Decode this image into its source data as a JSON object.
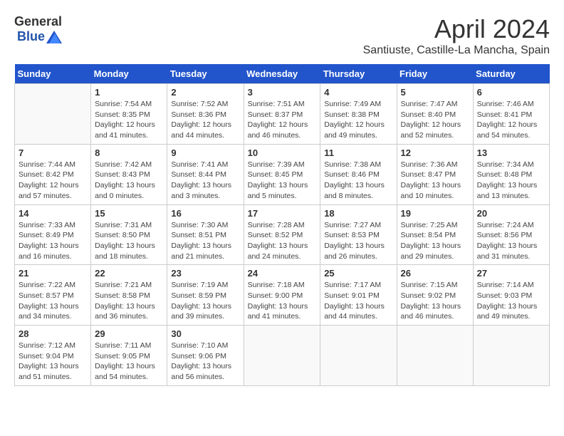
{
  "logo": {
    "general": "General",
    "blue": "Blue"
  },
  "title": "April 2024",
  "location": "Santiuste, Castille-La Mancha, Spain",
  "days_of_week": [
    "Sunday",
    "Monday",
    "Tuesday",
    "Wednesday",
    "Thursday",
    "Friday",
    "Saturday"
  ],
  "weeks": [
    [
      {
        "day": "",
        "info": ""
      },
      {
        "day": "1",
        "info": "Sunrise: 7:54 AM\nSunset: 8:35 PM\nDaylight: 12 hours\nand 41 minutes."
      },
      {
        "day": "2",
        "info": "Sunrise: 7:52 AM\nSunset: 8:36 PM\nDaylight: 12 hours\nand 44 minutes."
      },
      {
        "day": "3",
        "info": "Sunrise: 7:51 AM\nSunset: 8:37 PM\nDaylight: 12 hours\nand 46 minutes."
      },
      {
        "day": "4",
        "info": "Sunrise: 7:49 AM\nSunset: 8:38 PM\nDaylight: 12 hours\nand 49 minutes."
      },
      {
        "day": "5",
        "info": "Sunrise: 7:47 AM\nSunset: 8:40 PM\nDaylight: 12 hours\nand 52 minutes."
      },
      {
        "day": "6",
        "info": "Sunrise: 7:46 AM\nSunset: 8:41 PM\nDaylight: 12 hours\nand 54 minutes."
      }
    ],
    [
      {
        "day": "7",
        "info": "Sunrise: 7:44 AM\nSunset: 8:42 PM\nDaylight: 12 hours\nand 57 minutes."
      },
      {
        "day": "8",
        "info": "Sunrise: 7:42 AM\nSunset: 8:43 PM\nDaylight: 13 hours\nand 0 minutes."
      },
      {
        "day": "9",
        "info": "Sunrise: 7:41 AM\nSunset: 8:44 PM\nDaylight: 13 hours\nand 3 minutes."
      },
      {
        "day": "10",
        "info": "Sunrise: 7:39 AM\nSunset: 8:45 PM\nDaylight: 13 hours\nand 5 minutes."
      },
      {
        "day": "11",
        "info": "Sunrise: 7:38 AM\nSunset: 8:46 PM\nDaylight: 13 hours\nand 8 minutes."
      },
      {
        "day": "12",
        "info": "Sunrise: 7:36 AM\nSunset: 8:47 PM\nDaylight: 13 hours\nand 10 minutes."
      },
      {
        "day": "13",
        "info": "Sunrise: 7:34 AM\nSunset: 8:48 PM\nDaylight: 13 hours\nand 13 minutes."
      }
    ],
    [
      {
        "day": "14",
        "info": "Sunrise: 7:33 AM\nSunset: 8:49 PM\nDaylight: 13 hours\nand 16 minutes."
      },
      {
        "day": "15",
        "info": "Sunrise: 7:31 AM\nSunset: 8:50 PM\nDaylight: 13 hours\nand 18 minutes."
      },
      {
        "day": "16",
        "info": "Sunrise: 7:30 AM\nSunset: 8:51 PM\nDaylight: 13 hours\nand 21 minutes."
      },
      {
        "day": "17",
        "info": "Sunrise: 7:28 AM\nSunset: 8:52 PM\nDaylight: 13 hours\nand 24 minutes."
      },
      {
        "day": "18",
        "info": "Sunrise: 7:27 AM\nSunset: 8:53 PM\nDaylight: 13 hours\nand 26 minutes."
      },
      {
        "day": "19",
        "info": "Sunrise: 7:25 AM\nSunset: 8:54 PM\nDaylight: 13 hours\nand 29 minutes."
      },
      {
        "day": "20",
        "info": "Sunrise: 7:24 AM\nSunset: 8:56 PM\nDaylight: 13 hours\nand 31 minutes."
      }
    ],
    [
      {
        "day": "21",
        "info": "Sunrise: 7:22 AM\nSunset: 8:57 PM\nDaylight: 13 hours\nand 34 minutes."
      },
      {
        "day": "22",
        "info": "Sunrise: 7:21 AM\nSunset: 8:58 PM\nDaylight: 13 hours\nand 36 minutes."
      },
      {
        "day": "23",
        "info": "Sunrise: 7:19 AM\nSunset: 8:59 PM\nDaylight: 13 hours\nand 39 minutes."
      },
      {
        "day": "24",
        "info": "Sunrise: 7:18 AM\nSunset: 9:00 PM\nDaylight: 13 hours\nand 41 minutes."
      },
      {
        "day": "25",
        "info": "Sunrise: 7:17 AM\nSunset: 9:01 PM\nDaylight: 13 hours\nand 44 minutes."
      },
      {
        "day": "26",
        "info": "Sunrise: 7:15 AM\nSunset: 9:02 PM\nDaylight: 13 hours\nand 46 minutes."
      },
      {
        "day": "27",
        "info": "Sunrise: 7:14 AM\nSunset: 9:03 PM\nDaylight: 13 hours\nand 49 minutes."
      }
    ],
    [
      {
        "day": "28",
        "info": "Sunrise: 7:12 AM\nSunset: 9:04 PM\nDaylight: 13 hours\nand 51 minutes."
      },
      {
        "day": "29",
        "info": "Sunrise: 7:11 AM\nSunset: 9:05 PM\nDaylight: 13 hours\nand 54 minutes."
      },
      {
        "day": "30",
        "info": "Sunrise: 7:10 AM\nSunset: 9:06 PM\nDaylight: 13 hours\nand 56 minutes."
      },
      {
        "day": "",
        "info": ""
      },
      {
        "day": "",
        "info": ""
      },
      {
        "day": "",
        "info": ""
      },
      {
        "day": "",
        "info": ""
      }
    ]
  ]
}
